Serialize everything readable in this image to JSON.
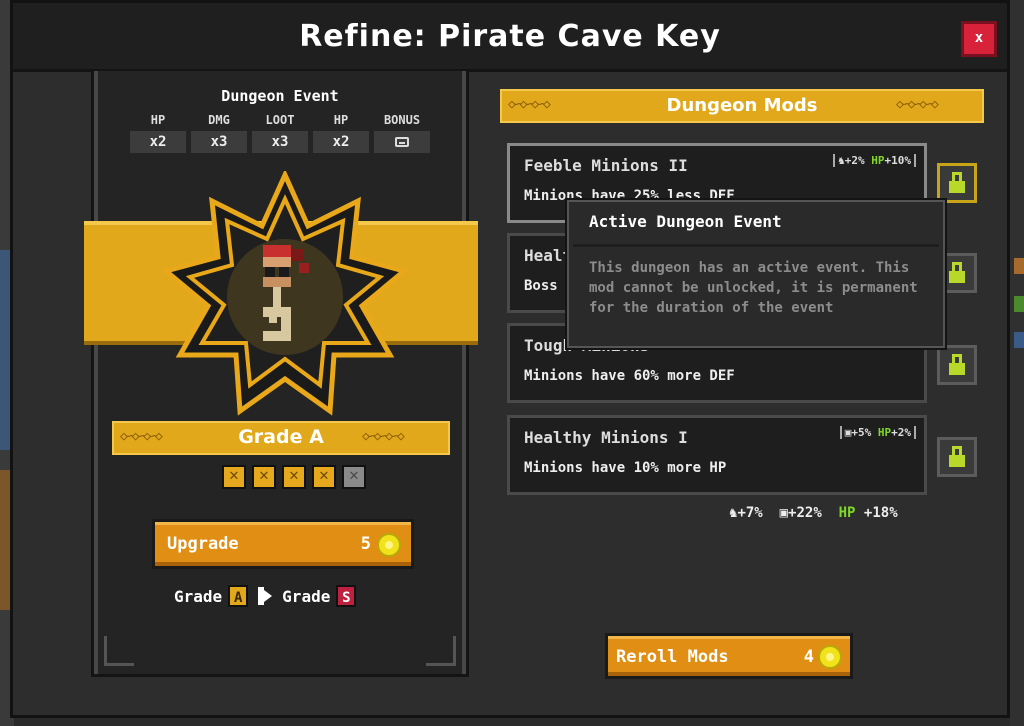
{
  "window": {
    "title": "Refine: Pirate Cave Key",
    "close_label": "x"
  },
  "event": {
    "title": "Dungeon Event",
    "stats": [
      {
        "label": "HP",
        "value": "x2"
      },
      {
        "label": "DMG",
        "value": "x3"
      },
      {
        "label": "LOOT",
        "value": "x3"
      },
      {
        "label": "HP",
        "value": "x2"
      },
      {
        "label": "BONUS",
        "icon": "chest-icon"
      }
    ]
  },
  "item": {
    "icon": "pirate-cave-key-icon",
    "grade_label": "Grade A",
    "stars_filled": 4,
    "stars_total": 5
  },
  "upgrade": {
    "label": "Upgrade",
    "cost": "5",
    "from_text": "Grade",
    "from_grade": "A",
    "to_text": "Grade",
    "to_grade": "S"
  },
  "mods": {
    "header": "Dungeon Mods",
    "items": [
      {
        "name": "Feeble Minions II",
        "description": "Minions have 25% less DEF",
        "bonus_a": "+2%",
        "bonus_hp_label": "HP",
        "bonus_hp": "+10%",
        "locked": true
      },
      {
        "name": "Healthy Boss",
        "description": "Boss has more HP",
        "locked": true
      },
      {
        "name": "Tough Minions",
        "description": "Minions have 60% more DEF",
        "locked": true
      },
      {
        "name": "Healthy Minions I",
        "description": "Minions have 10% more HP",
        "bonus_a": "+5%",
        "bonus_hp_label": "HP",
        "bonus_hp": "+2%",
        "locked": true
      }
    ],
    "totals": {
      "a": "+7%",
      "b": "+22%",
      "hp_label": "HP",
      "hp": "+18%"
    }
  },
  "tooltip": {
    "title": "Active Dungeon Event",
    "text": "This dungeon has an active event. This mod cannot be unlocked, it is permanent for the duration of the event"
  },
  "reroll": {
    "label": "Reroll Mods",
    "cost": "4"
  },
  "colors": {
    "accent_gold": "#e0a81a",
    "button_orange": "#e08f14",
    "close_red": "#d8223a",
    "hp_green": "#7ed82a",
    "grade_s": "#c02040"
  }
}
